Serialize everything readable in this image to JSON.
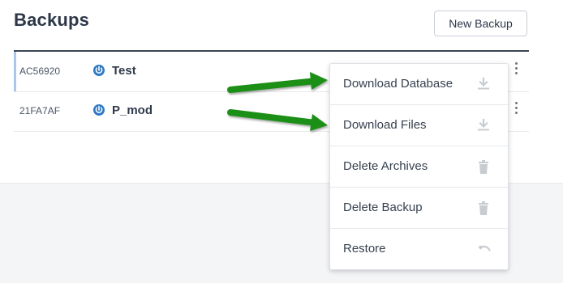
{
  "page": {
    "title": "Backups",
    "new_backup_label": "New Backup"
  },
  "backups": [
    {
      "id": "AC56920",
      "name": "Test",
      "status_icon": "power-icon",
      "selected": true
    },
    {
      "id": "21FA7AF",
      "name": "P_mod",
      "status_icon": "power-icon",
      "selected": false
    }
  ],
  "menu": {
    "items": [
      {
        "label": "Download Database",
        "icon": "download-icon"
      },
      {
        "label": "Download Files",
        "icon": "download-icon"
      },
      {
        "label": "Delete Archives",
        "icon": "trash-icon"
      },
      {
        "label": "Delete Backup",
        "icon": "trash-icon"
      },
      {
        "label": "Restore",
        "icon": "undo-icon"
      }
    ]
  },
  "colors": {
    "accent_blue": "#2f78c4",
    "arrow_green": "#1f8f18",
    "icon_gray": "#c8ccd1"
  }
}
